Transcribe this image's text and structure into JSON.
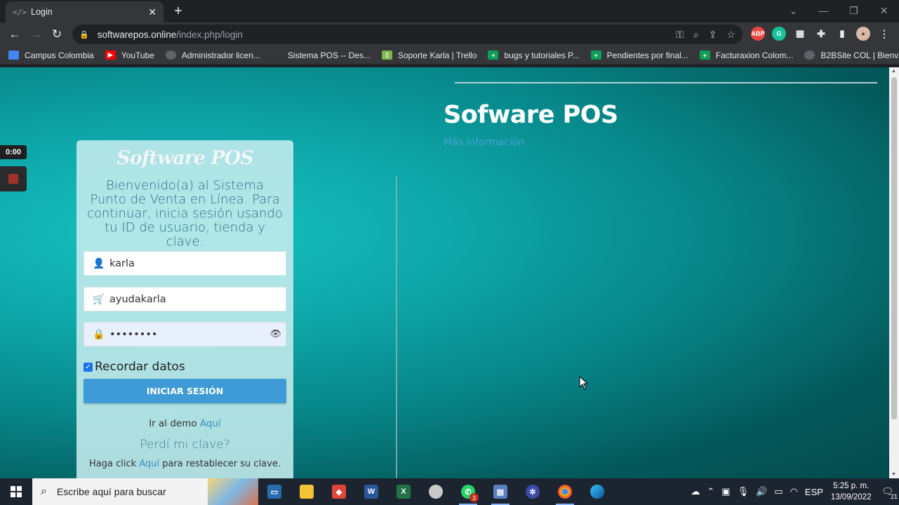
{
  "browser": {
    "tab_title": "Login",
    "tab_icon_text": "</>",
    "url_host": "softwarepos.online",
    "url_path": "/index.php/login"
  },
  "bookmarks": [
    {
      "label": "Campus Colombia",
      "icon_color": "#4285f4"
    },
    {
      "label": "YouTube",
      "icon_color": "#ff0000"
    },
    {
      "label": "Administrador licen...",
      "icon_color": "#5f6368"
    },
    {
      "label": "Sistema POS -- Des...",
      "icon_color": "#35363a"
    },
    {
      "label": "Soporte Karla | Trello",
      "icon_color": "#7ab648"
    },
    {
      "label": "bugs y tutoriales P...",
      "icon_color": "#0f9d58"
    },
    {
      "label": "Pendientes por final...",
      "icon_color": "#0f9d58"
    },
    {
      "label": "Facturaxion Colom...",
      "icon_color": "#0f9d58"
    },
    {
      "label": "B2BSite COL | Bienv...",
      "icon_color": "#5f6368"
    }
  ],
  "recorder": {
    "time": "0:00"
  },
  "hero": {
    "title": "Sofware POS",
    "more_info": "Más información"
  },
  "login": {
    "logo": "Software POS",
    "welcome": "Bienvenido(a) al Sistema Punto de Venta en Línea. Para continuar, inicia sesión usando tu ID de usuario, tienda y clave.",
    "user_value": "karla",
    "store_value": "ayudakarla",
    "password_value": "••••••••",
    "remember_label": "Recordar datos",
    "remember_checked": true,
    "submit_label": "INICIAR SESIÓN",
    "demo_prefix": "Ir al demo",
    "demo_link": "Aquí",
    "forgot_title": "Perdí mi clave?",
    "restore_prefix": "Haga click",
    "restore_link": "Aquí",
    "restore_suffix": "para restablecer su clave."
  },
  "taskbar": {
    "search_placeholder": "Escribe aquí para buscar",
    "whatsapp_badge": "3",
    "language": "ESP",
    "time": "5:25 p. m.",
    "date": "13/09/2022",
    "notifications": "21"
  }
}
